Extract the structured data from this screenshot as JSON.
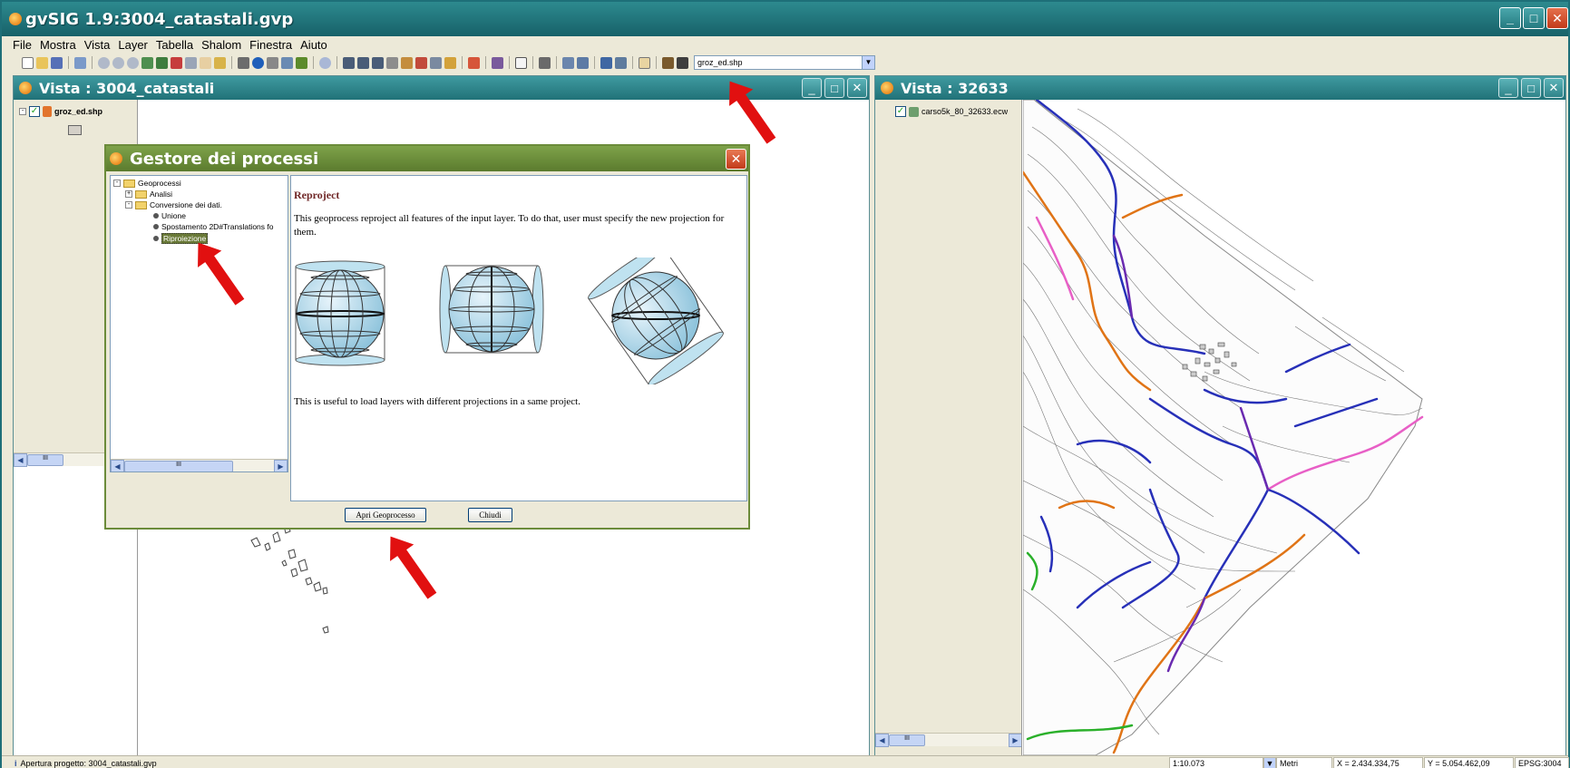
{
  "app": {
    "title": "gvSIG 1.9:3004_catastali.gvp",
    "controls": {
      "minimize": "_",
      "maximize": "□",
      "close": "✕"
    }
  },
  "menu": [
    "File",
    "Mostra",
    "Vista",
    "Layer",
    "Tabella",
    "Shalom",
    "Finestra",
    "Aiuto"
  ],
  "toolbar": {
    "layer_select_value": "groz_ed.shp",
    "combo_arrow": "▼"
  },
  "view_left": {
    "title": "Vista : 3004_catastali",
    "layer": {
      "name": "groz_ed.shp",
      "checked": "✓"
    },
    "scroll_left": "◀",
    "scroll_thumb": "III"
  },
  "view_right": {
    "title": "Vista : 32633",
    "layer": {
      "name": "carso5k_80_32633.ecw",
      "checked": "✓"
    },
    "scroll_left": "◀",
    "scroll_right": "▶",
    "scroll_thumb": "III"
  },
  "dialog": {
    "title": "Gestore dei processi",
    "close": "✕",
    "tree": {
      "root": "Geoprocessi",
      "analisi": "Analisi",
      "conversione": "Conversione dei dati.",
      "unione": "Unione",
      "spostamento": "Spostamento 2D#Translations fo",
      "riproiezione": "Riproiezione"
    },
    "tree_scroll": {
      "left": "◀",
      "right": "▶",
      "thumb": "III"
    },
    "content": {
      "heading": "Reproject",
      "description": "This geoprocess reproject all features of the input layer. To do that, user must specify the new projection for them.",
      "footer": "This is useful to load layers with different projections in a same project."
    },
    "buttons": {
      "open": "Apri Geoprocesso",
      "close": "Chiudi"
    }
  },
  "statusbar": {
    "info_icon": "i",
    "message": "Apertura progetto: 3004_catastali.gvp",
    "scale": "1:10.073",
    "units": "Metri",
    "x": "X = 2.434.334,75",
    "y": "Y = 5.054.462,09",
    "epsg": "EPSG:3004"
  },
  "colors": {
    "titlebar": "#1e6f78",
    "dialog_titlebar": "#6b8b3a",
    "selection": "#6a7a38",
    "arrow": "#e11010",
    "map_blue": "#2730b8",
    "map_orange": "#e07416",
    "map_pink": "#e85fc6"
  }
}
